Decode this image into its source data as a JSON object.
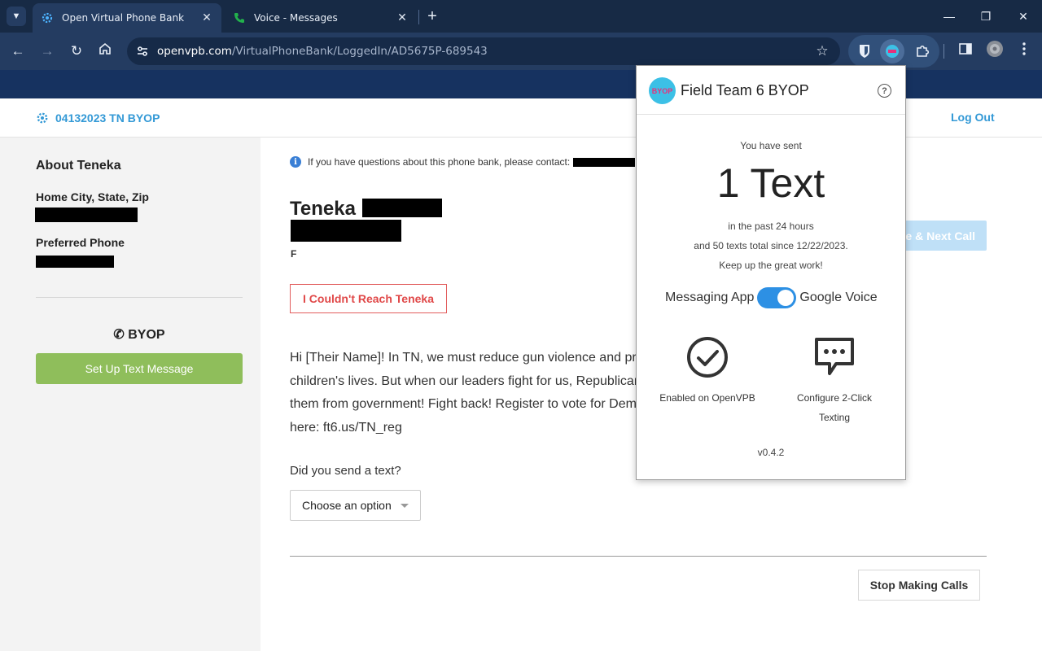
{
  "browser": {
    "tabs": [
      {
        "title": "Open Virtual Phone Bank",
        "active": true
      },
      {
        "title": "Voice - Messages",
        "active": false
      }
    ],
    "url": {
      "host": "openvpb.com",
      "path": "/VirtualPhoneBank/LoggedIn/AD5675P-689543"
    }
  },
  "header": {
    "brand": "04132023 TN BYOP",
    "logout": "Log Out"
  },
  "sidebar": {
    "title": "About Teneka",
    "home_label": "Home City, State, Zip",
    "phone_label": "Preferred Phone",
    "byop_title": "BYOP",
    "text_button": "Set Up Text Message"
  },
  "main": {
    "info_text": "If you have questions about this phone bank, please contact:",
    "first_name": "Teneka",
    "gender": "F",
    "cant_reach": "I Couldn't Reach Teneka",
    "next_call": "e & Next Call",
    "script_lines": [
      "Hi [Their Name]! In TN, we must reduce gun violence and pr",
      "children's lives. But when our leaders fight for us, Republican",
      "them from government! Fight back! Register to vote for Dem",
      "here: ft6.us/TN_reg"
    ],
    "send_question": "Did you send a text?",
    "select_value": "Choose an option",
    "stop_button": "Stop Making Calls"
  },
  "popup": {
    "title": "Field Team 6 BYOP",
    "logo_text": "BYOP",
    "sent_pre": "You have sent",
    "sent_count": "1 Text",
    "sent_line1": "in the past 24 hours",
    "sent_line2": "and 50 texts total since 12/22/2023.",
    "sent_line3": "Keep up the great work!",
    "toggle_left": "Messaging App",
    "toggle_right": "Google Voice",
    "feature_enabled": "Enabled on OpenVPB",
    "feature_configure_1": "Configure 2-Click",
    "feature_configure_2": "Texting",
    "version": "v0.4.2"
  },
  "colors": {
    "brand_blue": "#3399d6",
    "button_green": "#8fbe5b",
    "danger_red": "#e04848",
    "toggle_blue": "#2d90e4"
  },
  "icons": [
    "tab-search-icon",
    "gear-icon",
    "phone-icon",
    "close-icon",
    "plus-icon",
    "back-icon",
    "forward-icon",
    "reload-icon",
    "home-icon",
    "tune-icon",
    "star-icon",
    "bitwarden-icon",
    "byop-extension-icon",
    "puzzle-icon",
    "side-panel-icon",
    "profile-avatar",
    "more-icon",
    "info-icon",
    "help-icon",
    "check-circle-icon",
    "chat-bubble-icon",
    "caret-down-icon"
  ]
}
